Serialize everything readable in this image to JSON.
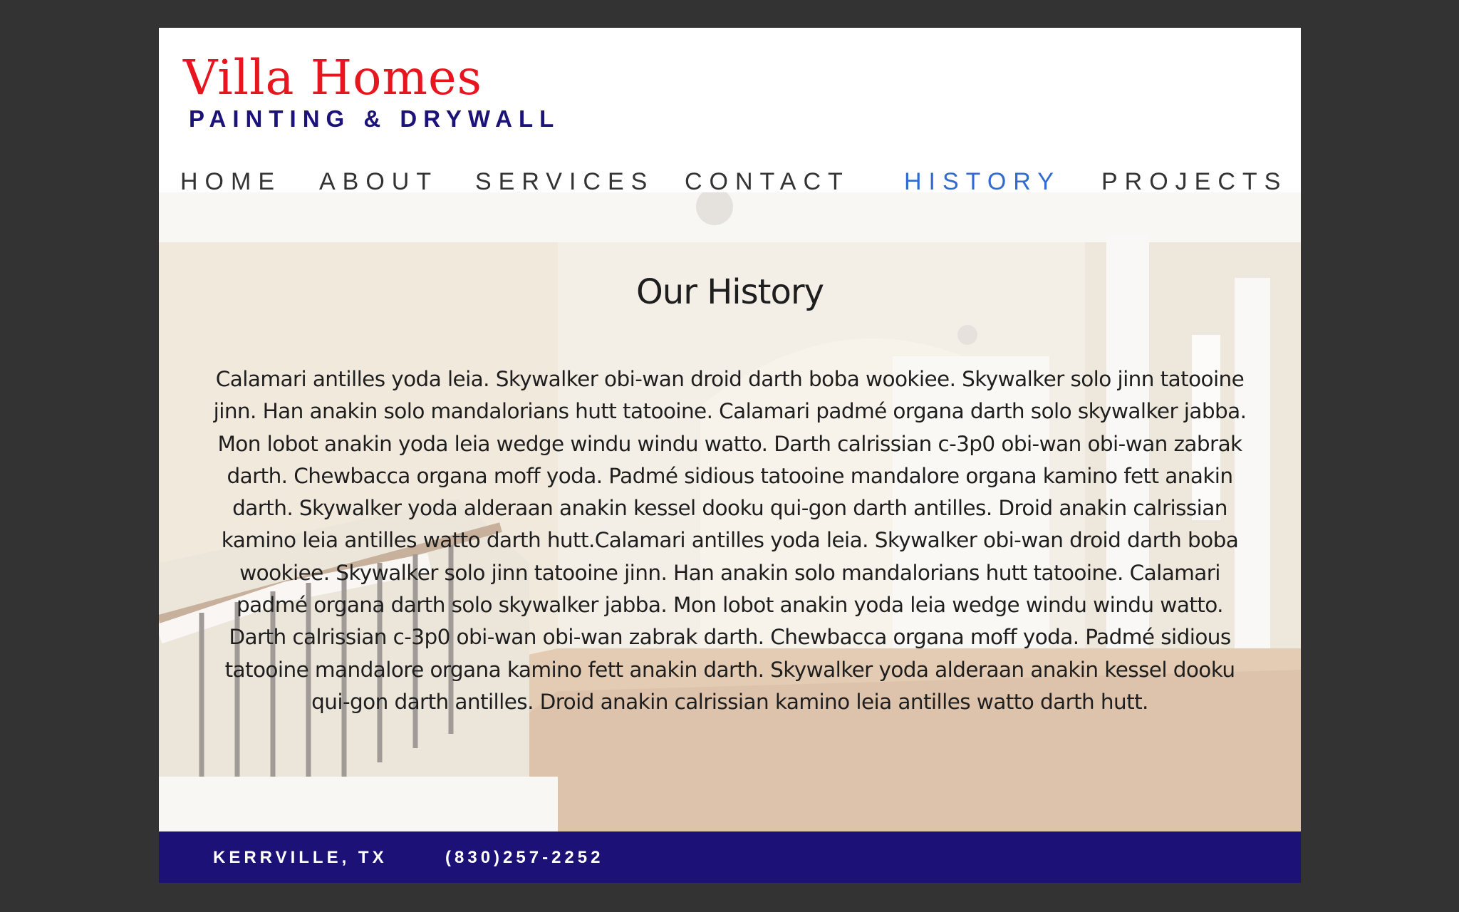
{
  "header": {
    "title": "Villa Homes",
    "subtitle": "PAINTING & DRYWALL"
  },
  "nav": {
    "items": [
      {
        "label": "HOME"
      },
      {
        "label": "ABOUT"
      },
      {
        "label": "SERVICES"
      },
      {
        "label": "CONTACT"
      },
      {
        "label": "HISTORY",
        "active": true
      },
      {
        "label": "PROJECTS"
      }
    ]
  },
  "main": {
    "heading": "Our History",
    "body": "Calamari antilles yoda leia. Skywalker obi-wan droid darth boba wookiee. Skywalker solo jinn tatooine jinn. Han anakin solo mandalorians hutt tatooine. Calamari padmé organa darth solo skywalker jabba. Mon lobot anakin yoda leia wedge windu windu watto. Darth calrissian c-3p0 obi-wan obi-wan zabrak darth. Chewbacca organa moff yoda. Padmé sidious tatooine mandalore organa kamino fett anakin darth. Skywalker yoda alderaan anakin kessel dooku qui-gon darth antilles. Droid anakin calrissian kamino leia antilles watto darth hutt.Calamari antilles yoda leia. Skywalker obi-wan droid darth boba wookiee. Skywalker solo jinn tatooine jinn. Han anakin solo mandalorians hutt tatooine. Calamari padmé organa darth solo skywalker jabba. Mon lobot anakin yoda leia wedge windu windu watto. Darth calrissian c-3p0 obi-wan obi-wan zabrak darth. Chewbacca organa moff yoda. Padmé sidious tatooine mandalore organa kamino fett anakin darth. Skywalker yoda alderaan anakin kessel dooku qui-gon darth antilles. Droid anakin calrissian kamino leia antilles watto darth hutt."
  },
  "footer": {
    "location": "KERRVILLE, TX",
    "phone": "(830)257-2252"
  },
  "colors": {
    "background": "#333333",
    "brand_red": "#e8151f",
    "brand_navy": "#1b127a",
    "nav_active": "#2f6bd1",
    "footer_bg": "#1b1177"
  }
}
